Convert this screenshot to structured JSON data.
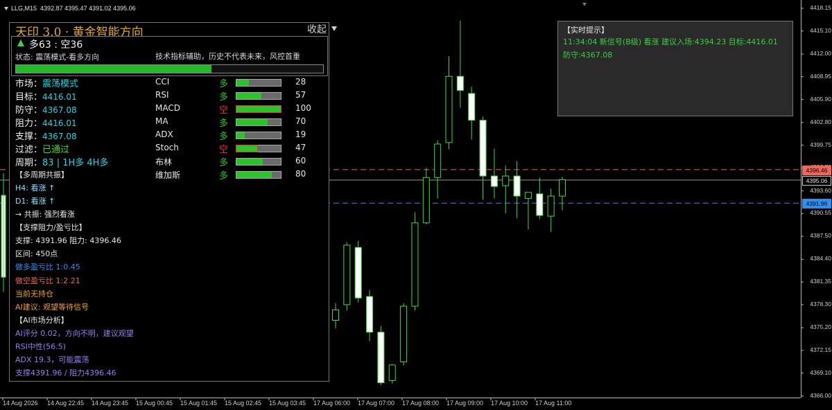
{
  "header": {
    "symbol": "LLG,M15",
    "ohlc": "4392.87 4395.47 4391.02 4395.06"
  },
  "price_scale": [
    "4418.15",
    "4415.10",
    "4412.00",
    "4408.95",
    "4405.90",
    "4402.80",
    "4399.75",
    "4396.70",
    "4393.60",
    "4390.55",
    "4387.50",
    "4384.40",
    "4381.35",
    "4378.30",
    "4375.20",
    "4372.15",
    "4369.10",
    "4366.00"
  ],
  "price_tags": [
    {
      "text": "4396.46",
      "color": "#f0665a",
      "bg": "#f0665a",
      "fg": "#000000"
    },
    {
      "text": "4395.06",
      "color": "#cfcfcf",
      "bg": "#000000",
      "fg": "#e6e6e6"
    },
    {
      "text": "4391.96",
      "color": "#2d8ff0",
      "bg": "#2d8ff0",
      "fg": "#000000"
    }
  ],
  "time_axis": [
    "14 Aug 2026",
    "14 Aug 22:45",
    "14 Aug 23:45",
    "15 Aug 00:45",
    "15 Aug 01:45",
    "15 Aug 02:45",
    "15 Aug 03:45",
    "17 Aug 06:00",
    "17 Aug 07:00",
    "17 Aug 08:00",
    "17 Aug 09:00",
    "17 Aug 10:00",
    "17 Aug 11:00"
  ],
  "candles": [
    {
      "o": 4376.2,
      "h": 4378.5,
      "l": 4375.1,
      "c": 4377.6
    },
    {
      "o": 4378.3,
      "h": 4386.7,
      "l": 4377.5,
      "c": 4386.3
    },
    {
      "o": 4386.0,
      "h": 4386.9,
      "l": 4378.6,
      "c": 4379.2
    },
    {
      "o": 4379.4,
      "h": 4380.3,
      "l": 4373.4,
      "c": 4374.6
    },
    {
      "o": 4374.6,
      "h": 4375.4,
      "l": 4367.5,
      "c": 4367.8
    },
    {
      "o": 4368.1,
      "h": 4370.3,
      "l": 4367.7,
      "c": 4370.2
    },
    {
      "o": 4370.6,
      "h": 4378.5,
      "l": 4370.1,
      "c": 4378.1
    },
    {
      "o": 4378.1,
      "h": 4390.7,
      "l": 4377.5,
      "c": 4389.3
    },
    {
      "o": 4389.3,
      "h": 4396.7,
      "l": 4389.1,
      "c": 4395.4
    },
    {
      "o": 4395.4,
      "h": 4400.4,
      "l": 4392.6,
      "c": 4399.9
    },
    {
      "o": 4400.1,
      "h": 4411.7,
      "l": 4399.2,
      "c": 4409.0
    },
    {
      "o": 4409.0,
      "h": 4416.5,
      "l": 4404.8,
      "c": 4407.1
    },
    {
      "o": 4406.7,
      "h": 4407.6,
      "l": 4400.5,
      "c": 4403.1
    },
    {
      "o": 4403.1,
      "h": 4403.6,
      "l": 4392.4,
      "c": 4395.6
    },
    {
      "o": 4395.6,
      "h": 4399.3,
      "l": 4392.6,
      "c": 4394.2
    },
    {
      "o": 4394.3,
      "h": 4397.0,
      "l": 4390.6,
      "c": 4395.6
    },
    {
      "o": 4395.6,
      "h": 4397.6,
      "l": 4389.9,
      "c": 4392.9
    },
    {
      "o": 4392.6,
      "h": 4393.4,
      "l": 4388.4,
      "c": 4393.4
    },
    {
      "o": 4393.2,
      "h": 4395.4,
      "l": 4389.8,
      "c": 4390.3
    },
    {
      "o": 4390.2,
      "h": 4393.9,
      "l": 4388.1,
      "c": 4392.9
    },
    {
      "o": 4392.9,
      "h": 4395.5,
      "l": 4391.0,
      "c": 4395.1
    }
  ],
  "panel": {
    "title": "天印 3.0 · 黄金智能方向",
    "collapse": "收起",
    "summary_count": "多63 : 空36",
    "summary_state": "状态: 震荡模式-看多方向",
    "summary_disclaimer": "技术指标辅助，历史不代表未来，风控首重",
    "progress_pct": 63.6,
    "info": [
      {
        "label": "市场：",
        "value": "震荡模式"
      },
      {
        "label": "目标：",
        "value": "4416.01"
      },
      {
        "label": "防守：",
        "value": "4367.08"
      },
      {
        "label": "阻力：",
        "value": "4416.01"
      },
      {
        "label": "支撑：",
        "value": "4367.08"
      },
      {
        "label": "过滤：",
        "value": "已通过"
      },
      {
        "label": "周期：",
        "value": "83 | 1H多 4H多"
      }
    ],
    "indicators": [
      {
        "name": "CCI",
        "dir": "多",
        "dir_color": "#2cc22c",
        "pct": 28,
        "val": "28"
      },
      {
        "name": "RSI",
        "dir": "多",
        "dir_color": "#2cc22c",
        "pct": 57,
        "val": "57"
      },
      {
        "name": "MACD",
        "dir": "空",
        "dir_color": "#f03030",
        "pct": 100,
        "val": "100"
      },
      {
        "name": "MA",
        "dir": "多",
        "dir_color": "#2cc22c",
        "pct": 70,
        "val": "70"
      },
      {
        "name": "ADX",
        "dir": "多",
        "dir_color": "#2cc22c",
        "pct": 19,
        "val": "19"
      },
      {
        "name": "Stoch",
        "dir": "空",
        "dir_color": "#f03030",
        "pct": 47,
        "val": "47"
      },
      {
        "name": "布林",
        "dir": "多",
        "dir_color": "#2cc22c",
        "pct": 60,
        "val": "60"
      },
      {
        "name": "维加斯",
        "dir": "多",
        "dir_color": "#2cc22c",
        "pct": 80,
        "val": "80"
      }
    ],
    "lines": [
      {
        "text": "【多周期共振】",
        "color": "#e8e8e8"
      },
      {
        "text": "H4: 看涨 ↑",
        "color": "#8fe0ff"
      },
      {
        "text": "D1: 看涨 ↑",
        "color": "#8fe0ff"
      },
      {
        "text": "→ 共振: 强烈看涨",
        "color": "#e8e8e8"
      },
      {
        "text": "【支撑阻力/盈亏比】",
        "color": "#e8e8e8"
      },
      {
        "text": "支撑: 4391.96  阻力: 4396.46",
        "color": "#e8e8e8"
      },
      {
        "text": "区间: 450点",
        "color": "#e8e8e8"
      },
      {
        "text": "做多盈亏比 1:0.45",
        "color": "#2d8ff0"
      },
      {
        "text": "做空盈亏比 1:2.21",
        "color": "#f0665a"
      },
      {
        "text": "当前无持仓",
        "color": "#f0a030"
      },
      {
        "text": "AI建议: 观望等待信号",
        "color": "#f0a030"
      },
      {
        "text": "【AI市场分析】",
        "color": "#e8e8e8"
      },
      {
        "text": "AI评分 0.02，方向不明，建议观望",
        "color": "#9a7ef0"
      },
      {
        "text": "RSI中性(56.5)",
        "color": "#9a7ef0"
      },
      {
        "text": "ADX 19.3，可能震荡",
        "color": "#9a7ef0"
      },
      {
        "text": "支撑4391.96 / 阻力4396.46",
        "color": "#9a7ef0"
      }
    ]
  },
  "realtime": {
    "title": "【实时提示】",
    "line1": "11:34:04 新信号(B级) 看涨 建议入场:4394.23 目标:4416.01",
    "line2": "防守:4367.08"
  }
}
